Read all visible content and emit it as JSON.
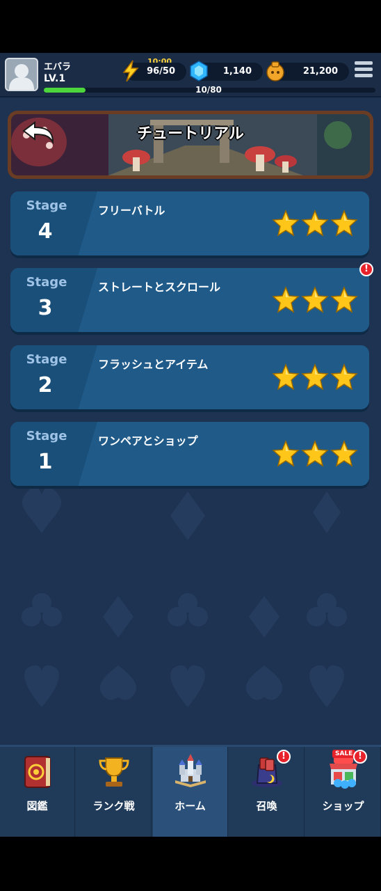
{
  "player": {
    "name": "エバラ",
    "level": "LV.1",
    "xp_text": "10/80",
    "xp_progress": 0.125
  },
  "resources": {
    "energy_timer": "10:00",
    "energy": "96/50",
    "gems": "1,140",
    "coins": "21,200"
  },
  "banner": {
    "title": "チュートリアル"
  },
  "stages": [
    {
      "label": "Stage",
      "number": "4",
      "title": "フリーバトル",
      "stars": 3,
      "alert": false
    },
    {
      "label": "Stage",
      "number": "3",
      "title": "ストレートとスクロール",
      "stars": 3,
      "alert": true
    },
    {
      "label": "Stage",
      "number": "2",
      "title": "フラッシュとアイテム",
      "stars": 3,
      "alert": false
    },
    {
      "label": "Stage",
      "number": "1",
      "title": "ワンペアとショップ",
      "stars": 3,
      "alert": false
    }
  ],
  "nav": [
    {
      "label": "図鑑",
      "icon": "book-icon",
      "active": false,
      "alert": false
    },
    {
      "label": "ランク戦",
      "icon": "trophy-icon",
      "active": false,
      "alert": false
    },
    {
      "label": "ホーム",
      "icon": "castle-icon",
      "active": true,
      "alert": false
    },
    {
      "label": "召喚",
      "icon": "magic-hat-icon",
      "active": false,
      "alert": true
    },
    {
      "label": "ショップ",
      "icon": "shop-icon",
      "active": false,
      "alert": true,
      "badge": "SALE"
    }
  ],
  "colors": {
    "star": "#ffc61a",
    "alert": "#e8222a",
    "xp": "#4cd63b"
  }
}
